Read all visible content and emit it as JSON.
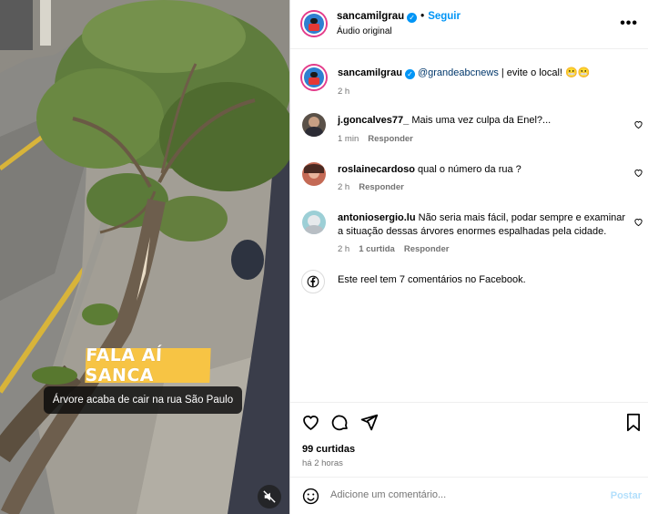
{
  "video": {
    "title_badge": "FALA AÍ SANCA",
    "caption": "Árvore acaba de cair na rua São Paulo",
    "mute_icon": "speaker-muted-icon"
  },
  "header": {
    "username": "sancamilgrau",
    "separator": "•",
    "follow_label": "Seguir",
    "audio_label": "Áudio original",
    "more_icon": "•••"
  },
  "post": {
    "username": "sancamilgrau",
    "mention": "@grandeabcnews",
    "text": " | evite o local! 😬😬",
    "time": "2 h"
  },
  "comments": [
    {
      "user": "j.goncalves77_",
      "text": " Mais uma vez culpa da Enel?...",
      "time": "1 min",
      "reply": "Responder"
    },
    {
      "user": "roslainecardoso",
      "text": " qual o número da rua ?",
      "time": "2 h",
      "reply": "Responder"
    },
    {
      "user": "antoniosergio.lu",
      "text": " Não seria mais fácil, podar sempre e examinar a situação dessas árvores enormes espalhadas pela cidade.",
      "time": "2 h",
      "likes": "1 curtida",
      "reply": "Responder"
    }
  ],
  "facebook_note": "Este reel tem 7 comentários no Facebook.",
  "likes_label": "99 curtidas",
  "time_ago": "há 2 horas",
  "add_comment": {
    "placeholder": "Adicione um comentário...",
    "post_label": "Postar"
  },
  "colors": {
    "accent": "#0095f6",
    "mention": "#00376b",
    "badge": "#f7c444",
    "post_disabled": "#b2dffc"
  }
}
